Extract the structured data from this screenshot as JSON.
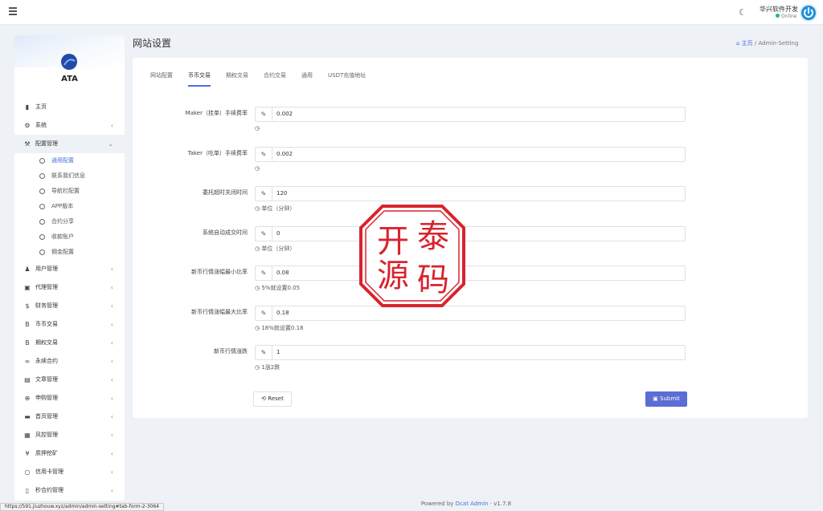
{
  "topbar": {
    "user_name": "华兴软件开发",
    "user_status": "Online"
  },
  "sidebar": {
    "brand": "ATA",
    "items": [
      {
        "label": "主页",
        "icon": "bar-chart-icon",
        "glyph": "▮",
        "chevron": false
      },
      {
        "label": "系统",
        "icon": "gear-icon",
        "glyph": "⚙",
        "chevron": true
      },
      {
        "label": "配置管理",
        "icon": "wrench-icon",
        "glyph": "⚒",
        "chevron": true,
        "open": true
      }
    ],
    "submenu": [
      {
        "label": "通用配置",
        "active": true
      },
      {
        "label": "联系我们信息",
        "active": false
      },
      {
        "label": "导航栏配置",
        "active": false
      },
      {
        "label": "APP版本",
        "active": false
      },
      {
        "label": "合约分享",
        "active": false
      },
      {
        "label": "收款账户",
        "active": false
      },
      {
        "label": "佣金配置",
        "active": false
      }
    ],
    "items_after": [
      {
        "label": "用户管理",
        "icon": "users-icon",
        "glyph": "♟"
      },
      {
        "label": "代理管理",
        "icon": "id-card-icon",
        "glyph": "▣"
      },
      {
        "label": "财务管理",
        "icon": "dollar-icon",
        "glyph": "$"
      },
      {
        "label": "币币交易",
        "icon": "bitcoin-icon",
        "glyph": "B"
      },
      {
        "label": "期权交易",
        "icon": "bitcoin-small-icon",
        "glyph": "B"
      },
      {
        "label": "永续合约",
        "icon": "link-icon",
        "glyph": "∞"
      },
      {
        "label": "文章管理",
        "icon": "newspaper-icon",
        "glyph": "▤"
      },
      {
        "label": "申购管理",
        "icon": "lifebuoy-icon",
        "glyph": "⊕"
      },
      {
        "label": "首页管理",
        "icon": "list-icon",
        "glyph": "▬"
      },
      {
        "label": "风控管理",
        "icon": "table-icon",
        "glyph": "▦"
      },
      {
        "label": "质押挖矿",
        "icon": "yen-icon",
        "glyph": "¥"
      },
      {
        "label": "信用卡管理",
        "icon": "circle-icon",
        "glyph": "○"
      },
      {
        "label": "秒合约管理",
        "icon": "file-icon",
        "glyph": "▯"
      }
    ]
  },
  "page": {
    "title": "网站设置",
    "breadcrumb_home": "主页",
    "breadcrumb_sep": "/",
    "breadcrumb_current": "Admin-Setting"
  },
  "tabs": [
    "网站配置",
    "币币交易",
    "期权交易",
    "合约交易",
    "通用",
    "USDT充值地址"
  ],
  "active_tab": 1,
  "fields": [
    {
      "label": "Maker（挂单）手续费率",
      "value": "0.002",
      "help": ""
    },
    {
      "label": "Taker（吃单）手续费率",
      "value": "0.002",
      "help": ""
    },
    {
      "label": "委托超时关闭时间",
      "value": "120",
      "help": "单位（分钟）"
    },
    {
      "label": "系统自动成交时间",
      "value": "0",
      "help": "单位（分钟）"
    },
    {
      "label": "新币行情涨幅最小比率",
      "value": "0.08",
      "help": "5%就设置0.05"
    },
    {
      "label": "新币行情涨幅最大比率",
      "value": "0.18",
      "help": "18%就设置0.18"
    },
    {
      "label": "新币行情涨跌",
      "value": "1",
      "help": "1涨2跌"
    }
  ],
  "buttons": {
    "reset": "Reset",
    "submit": "Submit"
  },
  "stamp": {
    "text": "开泰源码",
    "color": "#d9232e"
  },
  "footer": {
    "powered_prefix": "Powered by",
    "powered_brand": "Dcat Admin",
    "version": "· v1.7.8"
  },
  "status_url": "https://591.jiuzhouw.xyz/admin/admin-setting#tab-form-2-3064",
  "colors": {
    "accent": "#4a6ee0",
    "submit": "#5a6ed3",
    "online": "#21b978"
  }
}
